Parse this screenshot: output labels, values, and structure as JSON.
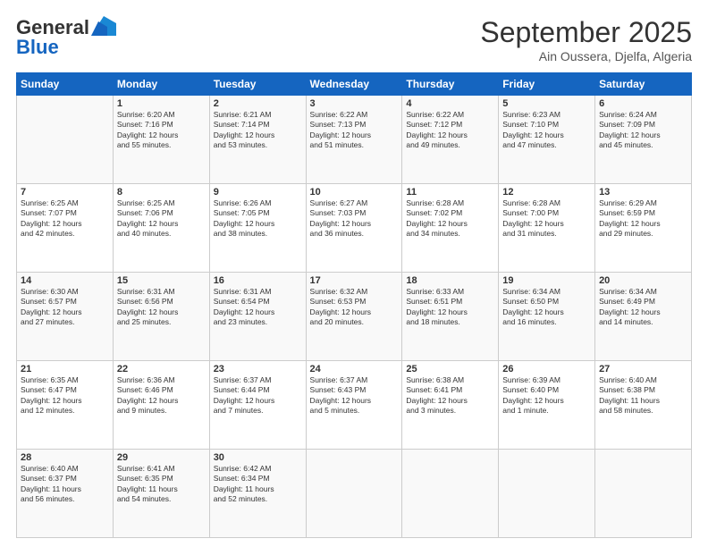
{
  "header": {
    "logo_line1": "General",
    "logo_line2": "Blue",
    "month": "September 2025",
    "location": "Ain Oussera, Djelfa, Algeria"
  },
  "days_of_week": [
    "Sunday",
    "Monday",
    "Tuesday",
    "Wednesday",
    "Thursday",
    "Friday",
    "Saturday"
  ],
  "weeks": [
    [
      {
        "day": "",
        "info": ""
      },
      {
        "day": "1",
        "info": "Sunrise: 6:20 AM\nSunset: 7:16 PM\nDaylight: 12 hours\nand 55 minutes."
      },
      {
        "day": "2",
        "info": "Sunrise: 6:21 AM\nSunset: 7:14 PM\nDaylight: 12 hours\nand 53 minutes."
      },
      {
        "day": "3",
        "info": "Sunrise: 6:22 AM\nSunset: 7:13 PM\nDaylight: 12 hours\nand 51 minutes."
      },
      {
        "day": "4",
        "info": "Sunrise: 6:22 AM\nSunset: 7:12 PM\nDaylight: 12 hours\nand 49 minutes."
      },
      {
        "day": "5",
        "info": "Sunrise: 6:23 AM\nSunset: 7:10 PM\nDaylight: 12 hours\nand 47 minutes."
      },
      {
        "day": "6",
        "info": "Sunrise: 6:24 AM\nSunset: 7:09 PM\nDaylight: 12 hours\nand 45 minutes."
      }
    ],
    [
      {
        "day": "7",
        "info": "Sunrise: 6:25 AM\nSunset: 7:07 PM\nDaylight: 12 hours\nand 42 minutes."
      },
      {
        "day": "8",
        "info": "Sunrise: 6:25 AM\nSunset: 7:06 PM\nDaylight: 12 hours\nand 40 minutes."
      },
      {
        "day": "9",
        "info": "Sunrise: 6:26 AM\nSunset: 7:05 PM\nDaylight: 12 hours\nand 38 minutes."
      },
      {
        "day": "10",
        "info": "Sunrise: 6:27 AM\nSunset: 7:03 PM\nDaylight: 12 hours\nand 36 minutes."
      },
      {
        "day": "11",
        "info": "Sunrise: 6:28 AM\nSunset: 7:02 PM\nDaylight: 12 hours\nand 34 minutes."
      },
      {
        "day": "12",
        "info": "Sunrise: 6:28 AM\nSunset: 7:00 PM\nDaylight: 12 hours\nand 31 minutes."
      },
      {
        "day": "13",
        "info": "Sunrise: 6:29 AM\nSunset: 6:59 PM\nDaylight: 12 hours\nand 29 minutes."
      }
    ],
    [
      {
        "day": "14",
        "info": "Sunrise: 6:30 AM\nSunset: 6:57 PM\nDaylight: 12 hours\nand 27 minutes."
      },
      {
        "day": "15",
        "info": "Sunrise: 6:31 AM\nSunset: 6:56 PM\nDaylight: 12 hours\nand 25 minutes."
      },
      {
        "day": "16",
        "info": "Sunrise: 6:31 AM\nSunset: 6:54 PM\nDaylight: 12 hours\nand 23 minutes."
      },
      {
        "day": "17",
        "info": "Sunrise: 6:32 AM\nSunset: 6:53 PM\nDaylight: 12 hours\nand 20 minutes."
      },
      {
        "day": "18",
        "info": "Sunrise: 6:33 AM\nSunset: 6:51 PM\nDaylight: 12 hours\nand 18 minutes."
      },
      {
        "day": "19",
        "info": "Sunrise: 6:34 AM\nSunset: 6:50 PM\nDaylight: 12 hours\nand 16 minutes."
      },
      {
        "day": "20",
        "info": "Sunrise: 6:34 AM\nSunset: 6:49 PM\nDaylight: 12 hours\nand 14 minutes."
      }
    ],
    [
      {
        "day": "21",
        "info": "Sunrise: 6:35 AM\nSunset: 6:47 PM\nDaylight: 12 hours\nand 12 minutes."
      },
      {
        "day": "22",
        "info": "Sunrise: 6:36 AM\nSunset: 6:46 PM\nDaylight: 12 hours\nand 9 minutes."
      },
      {
        "day": "23",
        "info": "Sunrise: 6:37 AM\nSunset: 6:44 PM\nDaylight: 12 hours\nand 7 minutes."
      },
      {
        "day": "24",
        "info": "Sunrise: 6:37 AM\nSunset: 6:43 PM\nDaylight: 12 hours\nand 5 minutes."
      },
      {
        "day": "25",
        "info": "Sunrise: 6:38 AM\nSunset: 6:41 PM\nDaylight: 12 hours\nand 3 minutes."
      },
      {
        "day": "26",
        "info": "Sunrise: 6:39 AM\nSunset: 6:40 PM\nDaylight: 12 hours\nand 1 minute."
      },
      {
        "day": "27",
        "info": "Sunrise: 6:40 AM\nSunset: 6:38 PM\nDaylight: 11 hours\nand 58 minutes."
      }
    ],
    [
      {
        "day": "28",
        "info": "Sunrise: 6:40 AM\nSunset: 6:37 PM\nDaylight: 11 hours\nand 56 minutes."
      },
      {
        "day": "29",
        "info": "Sunrise: 6:41 AM\nSunset: 6:35 PM\nDaylight: 11 hours\nand 54 minutes."
      },
      {
        "day": "30",
        "info": "Sunrise: 6:42 AM\nSunset: 6:34 PM\nDaylight: 11 hours\nand 52 minutes."
      },
      {
        "day": "",
        "info": ""
      },
      {
        "day": "",
        "info": ""
      },
      {
        "day": "",
        "info": ""
      },
      {
        "day": "",
        "info": ""
      }
    ]
  ]
}
